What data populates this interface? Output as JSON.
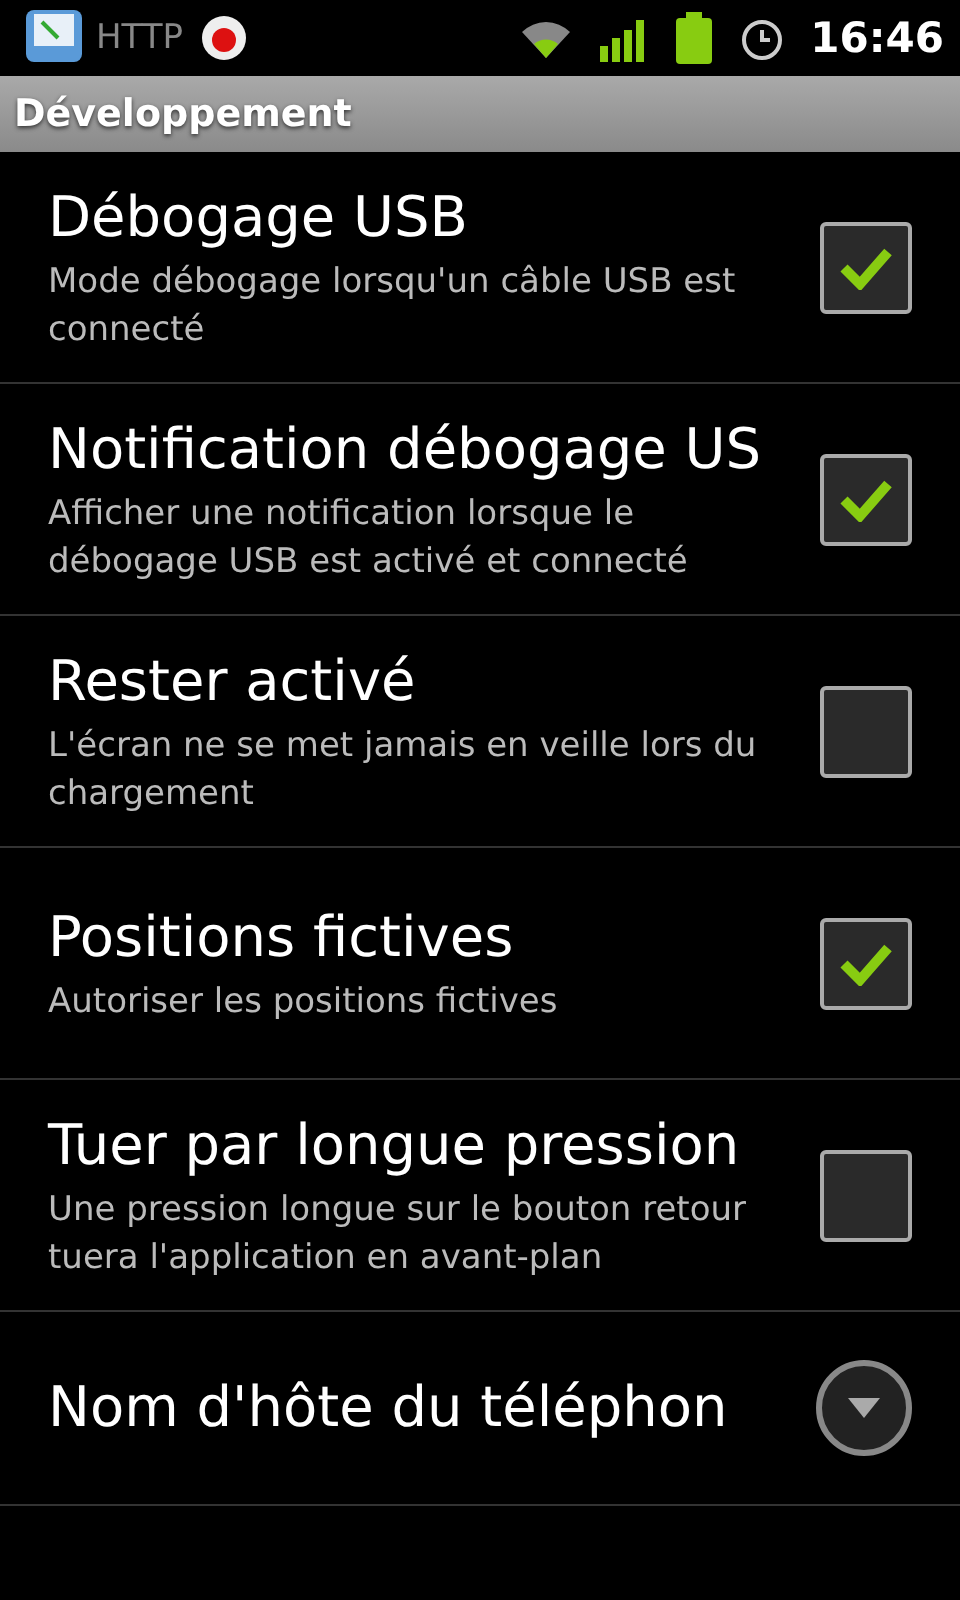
{
  "status_bar": {
    "app_label": "HTTP",
    "time": "16:46"
  },
  "header": {
    "title": "Développement"
  },
  "items": [
    {
      "kind": "checkbox",
      "title": "Débogage USB",
      "summary": "Mode débogage lorsqu'un câble USB est connecté",
      "checked": true
    },
    {
      "kind": "checkbox",
      "title": "Notification débogage US",
      "summary": "Afficher une notification lorsque le débogage USB est activé et connecté",
      "checked": true
    },
    {
      "kind": "checkbox",
      "title": "Rester activé",
      "summary": "L'écran ne se met jamais en veille lors du chargement",
      "checked": false
    },
    {
      "kind": "checkbox",
      "title": "Positions fictives",
      "summary": "Autoriser les positions fictives",
      "checked": true
    },
    {
      "kind": "checkbox",
      "title": "Tuer par longue pression",
      "summary": "Une pression longue sur le bouton retour tuera l'application en avant-plan",
      "checked": false
    },
    {
      "kind": "dropdown",
      "title": "Nom d'hôte du téléphon"
    }
  ]
}
